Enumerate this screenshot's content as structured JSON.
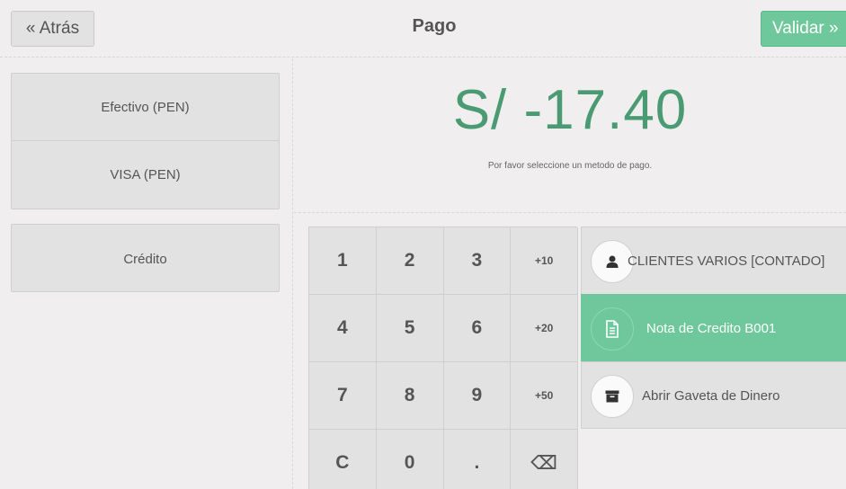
{
  "header": {
    "back_label": "« Atrás",
    "title": "Pago",
    "validate_label": "Validar »"
  },
  "payment_methods": [
    {
      "label": "Efectivo (PEN)"
    },
    {
      "label": "VISA (PEN)"
    }
  ],
  "credit_label": "Crédito",
  "amount": "S/ -17.40",
  "hint": "Por favor seleccione un metodo de pago.",
  "numpad": [
    {
      "label": "1",
      "name": "key-1"
    },
    {
      "label": "2",
      "name": "key-2"
    },
    {
      "label": "3",
      "name": "key-3"
    },
    {
      "label": "+10",
      "name": "key-plus-10",
      "small": true
    },
    {
      "label": "4",
      "name": "key-4"
    },
    {
      "label": "5",
      "name": "key-5"
    },
    {
      "label": "6",
      "name": "key-6"
    },
    {
      "label": "+20",
      "name": "key-plus-20",
      "small": true
    },
    {
      "label": "7",
      "name": "key-7"
    },
    {
      "label": "8",
      "name": "key-8"
    },
    {
      "label": "9",
      "name": "key-9"
    },
    {
      "label": "+50",
      "name": "key-plus-50",
      "small": true
    },
    {
      "label": "C",
      "name": "key-clear"
    },
    {
      "label": "0",
      "name": "key-0"
    },
    {
      "label": ".",
      "name": "key-decimal"
    },
    {
      "label": "⌫",
      "name": "key-backspace",
      "icon": "backspace-icon"
    }
  ],
  "actions": {
    "customer": {
      "label": "CLIENTES VARIOS [CONTADO]",
      "icon": "user-icon"
    },
    "credit_note": {
      "label": "Nota de Credito B001",
      "icon": "document-icon",
      "active": true
    },
    "cash_drawer": {
      "label": "Abrir Gaveta de Dinero",
      "icon": "archive-icon"
    }
  },
  "colors": {
    "accent": "#6ec89b",
    "amount": "#4a9b73",
    "background": "#f0eeee",
    "button": "#e2e2e2"
  }
}
